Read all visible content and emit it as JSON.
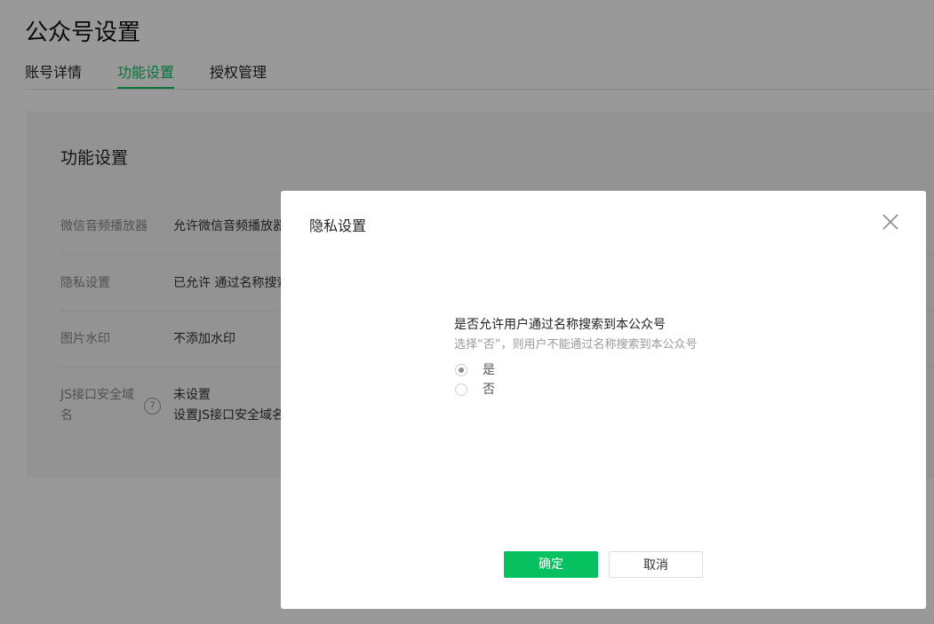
{
  "page": {
    "title": "公众号设置"
  },
  "tabs": [
    {
      "label": "账号详情"
    },
    {
      "label": "功能设置"
    },
    {
      "label": "授权管理"
    }
  ],
  "settings": {
    "title": "功能设置",
    "rows": [
      {
        "label": "微信音频播放器",
        "value": "允许微信音频播放器"
      },
      {
        "label": "隐私设置",
        "value": "已允许 通过名称搜索"
      },
      {
        "label": "图片水印",
        "value": "不添加水印"
      },
      {
        "label_line1": "JS接口安全域",
        "label_line2": "名",
        "value_line1": "未设置",
        "value_line2": "设置JS接口安全域名"
      }
    ]
  },
  "dialog": {
    "title": "隐私设置",
    "question": "是否允许用户通过名称搜索到本公众号",
    "hint": "选择“否”，则用户不能通过名称搜索到本公众号",
    "options": [
      {
        "label": "是",
        "checked": true
      },
      {
        "label": "否",
        "checked": false
      }
    ],
    "confirm_label": "确定",
    "cancel_label": "取消"
  },
  "colors": {
    "accent": "#07c160",
    "overlay": "rgba(0,0,0,0.40)"
  },
  "icons": {
    "close": "close-icon",
    "help": "question-circle-icon"
  }
}
